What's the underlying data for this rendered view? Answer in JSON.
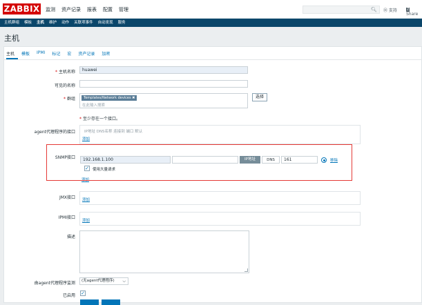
{
  "app": {
    "logo": "ZABBIX"
  },
  "topmenu": {
    "items": [
      "监测",
      "资产记录",
      "报表",
      "配置",
      "管理"
    ],
    "active": "配置"
  },
  "topright": {
    "support": "支持",
    "share": "Share"
  },
  "submenu": {
    "items": [
      "主机群组",
      "模板",
      "主机",
      "维护",
      "动作",
      "关联项事件",
      "自动发现",
      "服务"
    ],
    "active": "主机"
  },
  "page": {
    "title": "主机"
  },
  "tabs": {
    "items": [
      "主机",
      "模板",
      "IPMI",
      "标记",
      "宏",
      "资产记录",
      "加密"
    ],
    "active": "主机"
  },
  "form": {
    "hostname_label": "主机名称",
    "hostname_value": "huawei",
    "visible_name_label": "可见的名称",
    "visible_name_value": "",
    "groups_label": "群组",
    "group_tag": "Templates/Network devices",
    "group_tag_remove": "✖",
    "groups_placeholder": "在此输入搜索",
    "select_button": "选择",
    "interface_note": "至少存在一个接口。",
    "agent_label": "agent代理程序的接口",
    "agent_header": "IP地址  DNS名称  连接到  端口  默认",
    "agent_add": "添加",
    "snmp_label": "SNMP接口",
    "snmp_ip": "192.168.1.100",
    "snmp_dns": "",
    "snmp_connect_ip": "IP地址",
    "snmp_connect_dns": "DNS",
    "snmp_port": "161",
    "snmp_remove": "移除",
    "snmp_bulk_label": "使用大量请求",
    "snmp_add": "添加",
    "jmx_label": "JMX接口",
    "jmx_add": "添加",
    "ipmi_label": "IPMI接口",
    "ipmi_add": "添加",
    "description_label": "描述",
    "proxy_label": "由agent代理程序监测",
    "proxy_value": "(无agent代理程序)",
    "enabled_label": "已启用"
  },
  "icons": {
    "search": "search-icon",
    "support": "support-icon",
    "share": "share-icon"
  },
  "colors": {
    "logo": "#d40000",
    "submenu": "#0a466a",
    "link": "#0275b8",
    "highlight": "#e53935"
  }
}
